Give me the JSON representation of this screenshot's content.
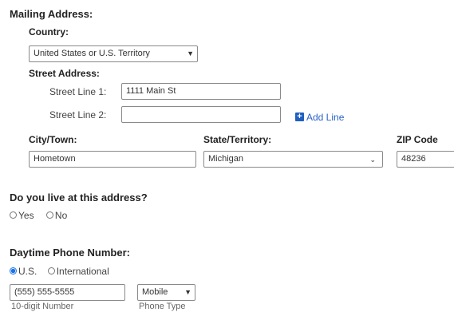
{
  "mailing": {
    "title": "Mailing Address:",
    "country_label": "Country:",
    "country_value": "United States or U.S. Territory",
    "street_title": "Street Address:",
    "line1_label": "Street Line 1:",
    "line1_value": "1111 Main St",
    "line2_label": "Street Line 2:",
    "line2_value": "",
    "add_line_label": "Add Line",
    "city_label": "City/Town:",
    "city_value": "Hometown",
    "state_label": "State/Territory:",
    "state_value": "Michigan",
    "zip_label": "ZIP Code",
    "zip_value": "48236"
  },
  "live_here": {
    "question": "Do you live at this address?",
    "options": [
      "Yes",
      "No"
    ],
    "selected": null
  },
  "phone": {
    "title": "Daytime Phone Number:",
    "options": [
      "U.S.",
      "International"
    ],
    "selected": "U.S.",
    "number_value": "(555) 555-5555",
    "number_hint": "10-digit Number",
    "type_value": "Mobile",
    "type_hint": "Phone Type"
  },
  "colors": {
    "accent": "#1a73e8",
    "link": "#2a62c9"
  }
}
